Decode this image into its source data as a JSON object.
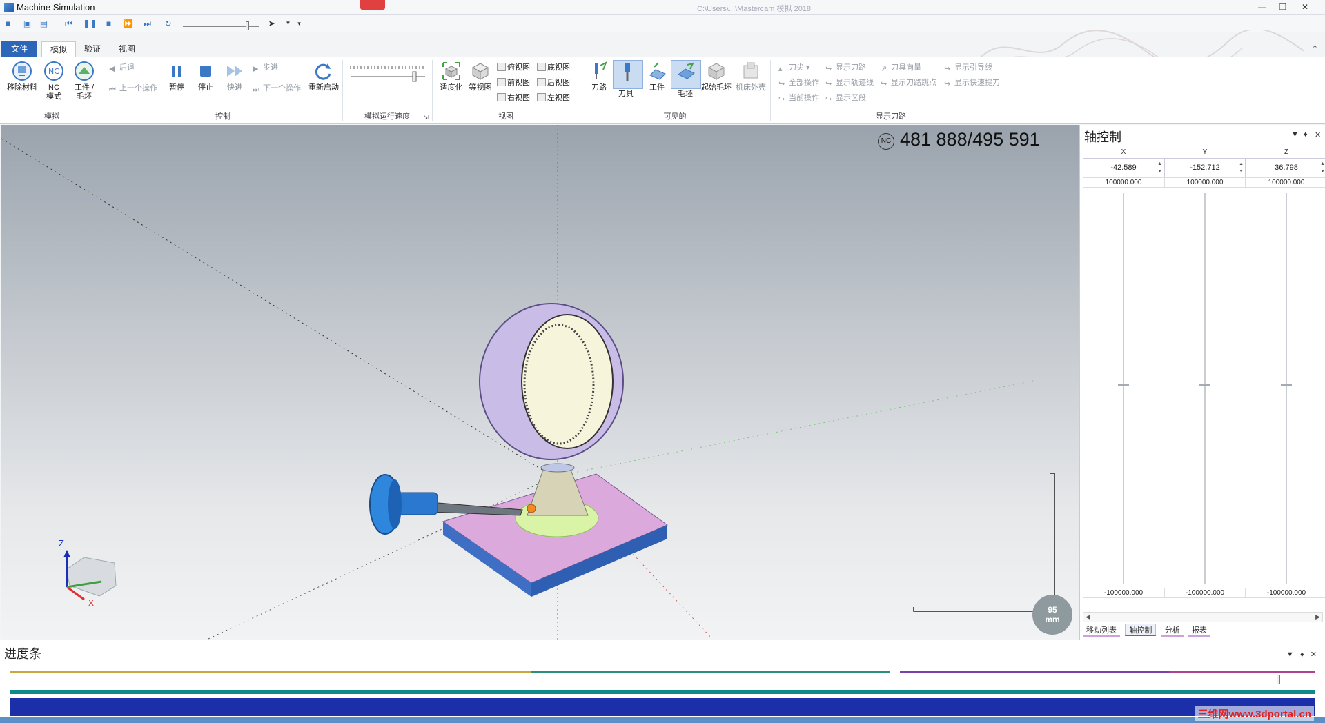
{
  "window": {
    "title": "Machine Simulation",
    "path_title": "C:\\Users\\...\\Mastercam 模拟 2018"
  },
  "tabs": [
    "文件",
    "模拟",
    "验证",
    "视图"
  ],
  "ribbon": {
    "group_sim": {
      "label": "模拟",
      "buttons": [
        "移除材料",
        "NC\n模式",
        "工件 /\n毛坯"
      ]
    },
    "group_control": {
      "label": "控制",
      "back": "后退",
      "prev_op": "上一个操作",
      "pause": "暂停",
      "stop": "停止",
      "fast": "快进",
      "step": "步进",
      "next_op": "下一个操作",
      "restart": "重新启动"
    },
    "group_speed": {
      "label": "模拟运行速度"
    },
    "group_view": {
      "label": "视图",
      "fit": "适度化",
      "iso": "等视图",
      "top": "俯视图",
      "bottom": "底视图",
      "front": "前视图",
      "back": "后视图",
      "right": "右视图",
      "left": "左视图"
    },
    "group_visible": {
      "label": "可见的",
      "toolpath": "刀路",
      "tool": "刀具",
      "workpiece": "工件",
      "stock": "毛坯",
      "initial_stock": "起始毛坯",
      "machine_housing": "机床外壳"
    },
    "group_show_path": {
      "label": "显示刀路",
      "tool_tip": "刀尖",
      "all_ops": "全部操作",
      "current_op": "当前操作",
      "show_path": "显示刀路",
      "show_track": "显示轨迹线",
      "show_zone": "显示区段",
      "tool_vector": "刀具向量",
      "show_path_points": "显示刀路跳点",
      "show_lead": "显示引导线",
      "show_rapid": "显示快速提刀"
    }
  },
  "viewport": {
    "nc_badge": "NC",
    "counter": "481 888/495 591",
    "scale_value": "95",
    "scale_unit": "mm",
    "axis_z": "Z",
    "axis_x": "X"
  },
  "axis_panel": {
    "title": "轴控制",
    "axes": [
      {
        "name": "X",
        "value": "-42.589",
        "max": "100000.000",
        "min": "-100000.000"
      },
      {
        "name": "Y",
        "value": "-152.712",
        "max": "100000.000",
        "min": "-100000.000"
      },
      {
        "name": "Z",
        "value": "36.798",
        "max": "100000.000",
        "min": "-100000.000"
      }
    ],
    "tabs": [
      "移动列表",
      "轴控制",
      "分析",
      "报表"
    ]
  },
  "progress": {
    "title": "进度条"
  },
  "watermark": "三维网www.3dportal.cn"
}
